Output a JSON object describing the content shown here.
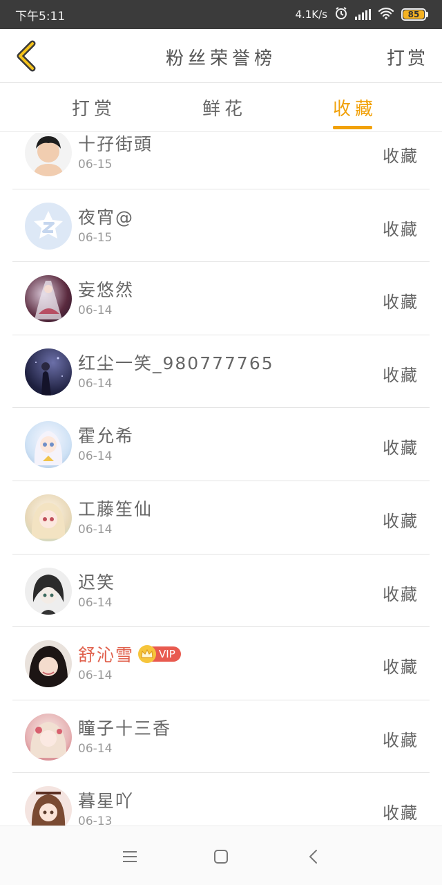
{
  "status_bar": {
    "time": "下午5:11",
    "network_speed": "4.1K/s",
    "battery_level": "85",
    "battery_color": "#f4b223"
  },
  "header": {
    "back_icon": "chevron-left-icon",
    "title": "粉丝荣誉榜",
    "action_label": "打赏"
  },
  "tabs": [
    {
      "label": "打赏",
      "active": false
    },
    {
      "label": "鲜花",
      "active": false
    },
    {
      "label": "收藏",
      "active": true
    }
  ],
  "accent_color": "#f1a10a",
  "fans": [
    {
      "name": "十孖街頭",
      "date": "06-15",
      "action": "收藏",
      "vip": false
    },
    {
      "name": "夜宵@",
      "date": "06-15",
      "action": "收藏",
      "vip": false
    },
    {
      "name": "妄悠然",
      "date": "06-14",
      "action": "收藏",
      "vip": false
    },
    {
      "name": "红尘一笑_980777765",
      "date": "06-14",
      "action": "收藏",
      "vip": false
    },
    {
      "name": "霍允希",
      "date": "06-14",
      "action": "收藏",
      "vip": false
    },
    {
      "name": "工藤笙仙",
      "date": "06-14",
      "action": "收藏",
      "vip": false
    },
    {
      "name": "迟笑",
      "date": "06-14",
      "action": "收藏",
      "vip": false
    },
    {
      "name": "舒沁雪",
      "date": "06-14",
      "action": "收藏",
      "vip": true,
      "vip_label": "VIP"
    },
    {
      "name": "瞳子十三香",
      "date": "06-14",
      "action": "收藏",
      "vip": false
    },
    {
      "name": "暮星吖",
      "date": "06-13",
      "action": "收藏",
      "vip": false
    }
  ],
  "nav_bar": {
    "menu_icon": "menu-icon",
    "home_icon": "home-square-icon",
    "back_icon": "back-triangle-icon"
  }
}
